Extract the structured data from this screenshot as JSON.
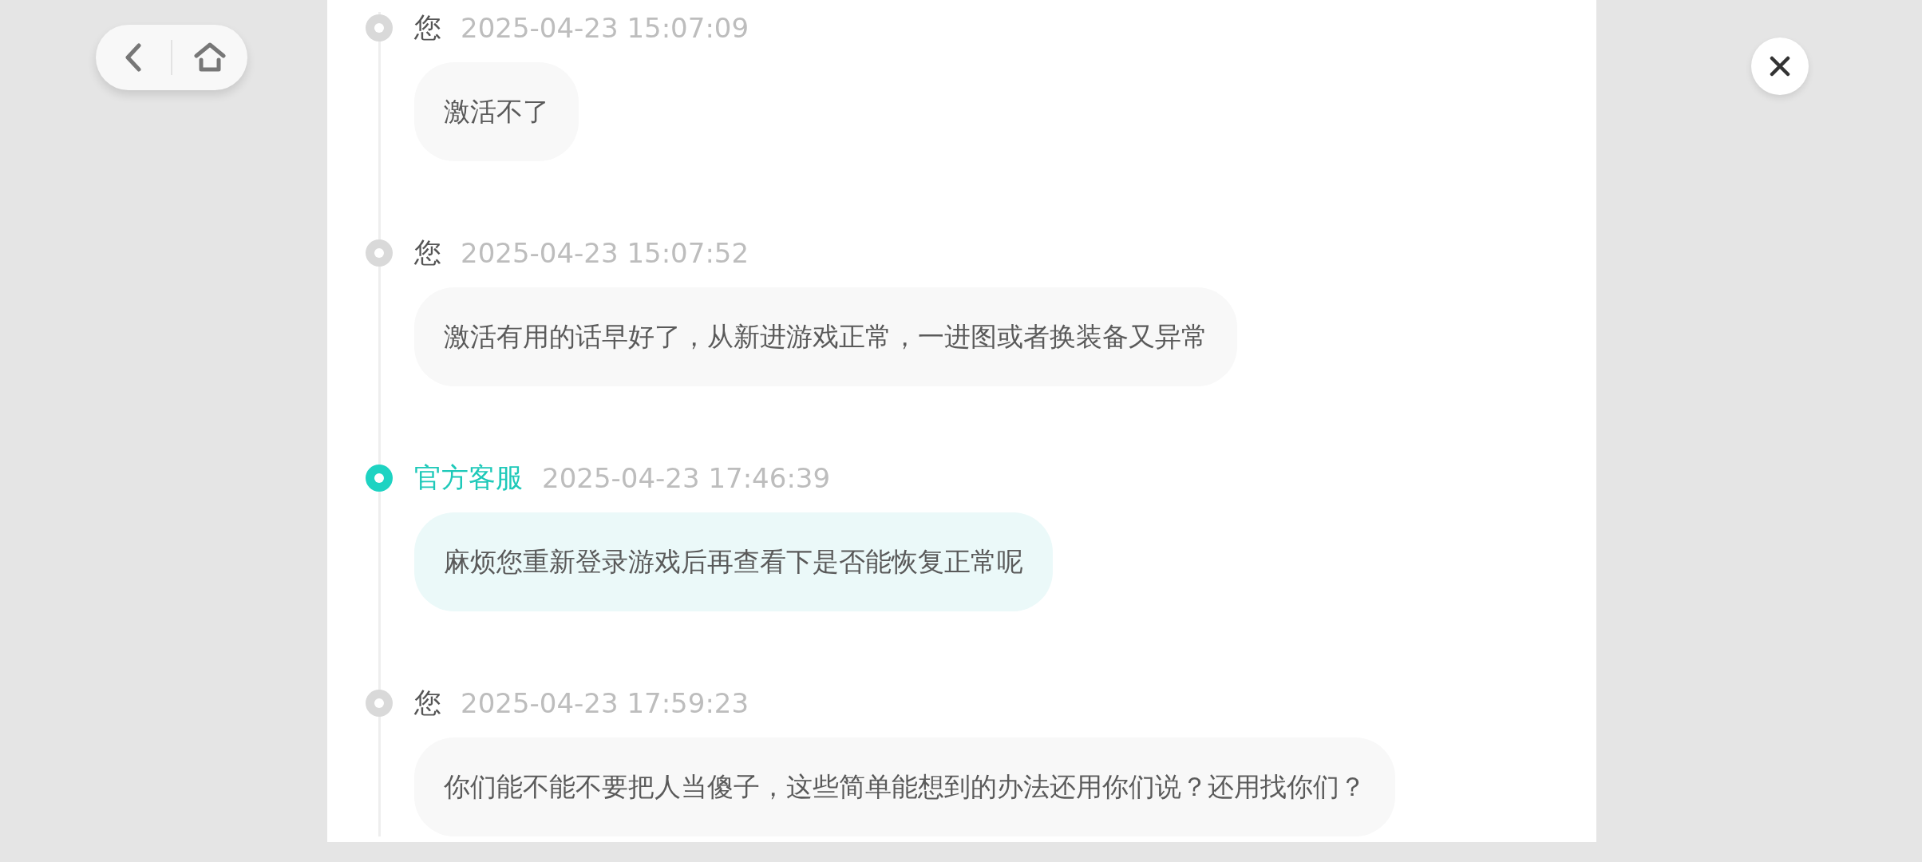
{
  "messages": [
    {
      "kind": "user",
      "sender": "您",
      "time": "2025-04-23 15:07:09",
      "text": "激活不了"
    },
    {
      "kind": "user",
      "sender": "您",
      "time": "2025-04-23 15:07:52",
      "text": "激活有用的话早好了，从新进游戏正常，一进图或者换装备又异常"
    },
    {
      "kind": "agent",
      "sender": "官方客服",
      "time": "2025-04-23 17:46:39",
      "text": "麻烦您重新登录游戏后再查看下是否能恢复正常呢"
    },
    {
      "kind": "user",
      "sender": "您",
      "time": "2025-04-23 17:59:23",
      "text": "你们能不能不要把人当傻子，这些简单能想到的办法还用你们说？还用找你们？"
    }
  ]
}
